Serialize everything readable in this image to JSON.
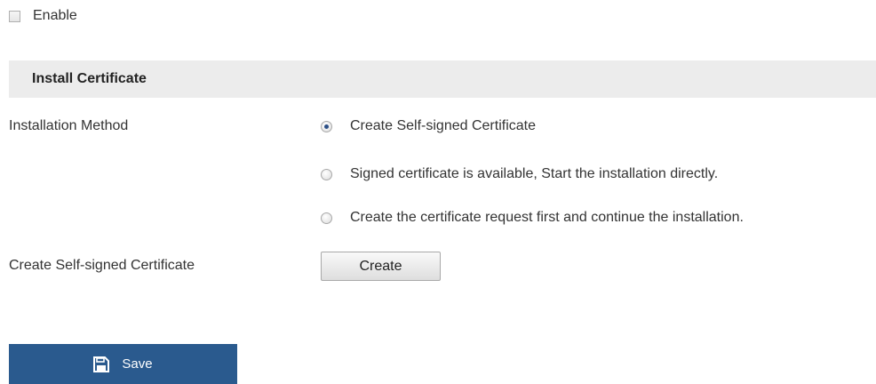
{
  "enable": {
    "label": "Enable",
    "checked": false
  },
  "section": {
    "title": "Install Certificate"
  },
  "installation_method": {
    "label": "Installation Method",
    "options": [
      {
        "label": "Create Self-signed Certificate",
        "selected": true
      },
      {
        "label": "Signed certificate is available, Start the installation directly.",
        "selected": false
      },
      {
        "label": "Create the certificate request first and continue the installation.",
        "selected": false
      }
    ]
  },
  "create_self_signed": {
    "label": "Create Self-signed Certificate",
    "button_label": "Create"
  },
  "save": {
    "label": "Save",
    "icon": "floppy-disk-icon"
  },
  "colors": {
    "save_button_bg": "#2a5a8e",
    "section_header_bg": "#ececec",
    "radio_selected_dot": "#2c4f86"
  }
}
